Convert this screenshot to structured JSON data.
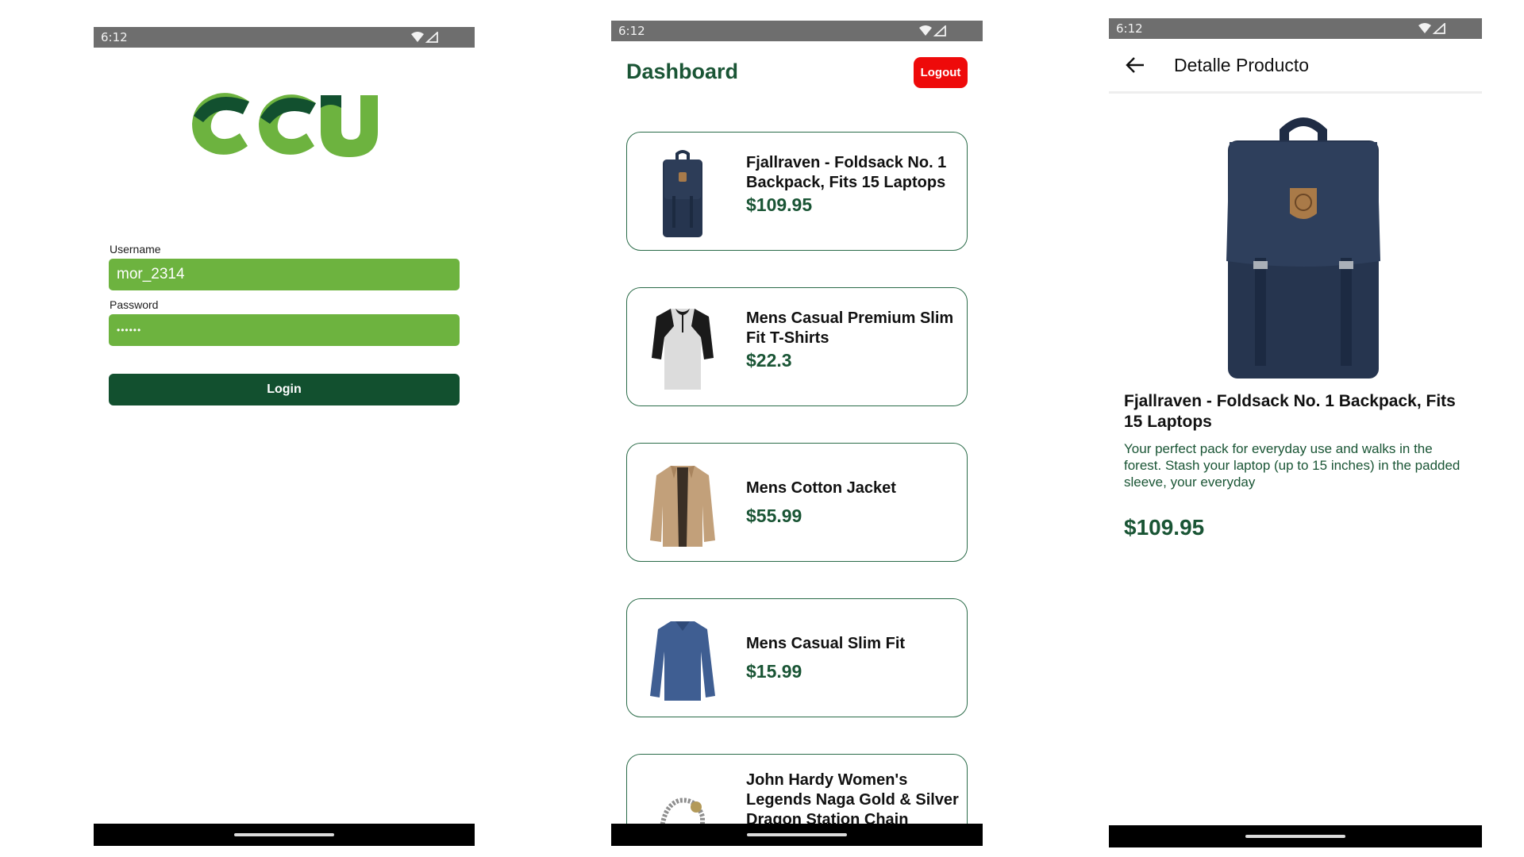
{
  "status_bar": {
    "time": "6:12"
  },
  "login": {
    "logo_text": "CCU",
    "username_label": "Username",
    "username_value": "mor_2314",
    "password_label": "Password",
    "password_value": "••••••",
    "login_button": "Login"
  },
  "dashboard": {
    "title": "Dashboard",
    "logout_button": "Logout",
    "products": [
      {
        "title": "Fjallraven - Foldsack No. 1 Backpack, Fits 15 Laptops",
        "price": "$109.95",
        "image": "backpack-image"
      },
      {
        "title": "Mens Casual Premium Slim Fit T-Shirts",
        "price": "$22.3",
        "image": "tshirt-image"
      },
      {
        "title": "Mens Cotton Jacket",
        "price": "$55.99",
        "image": "jacket-image"
      },
      {
        "title": "Mens Casual Slim Fit",
        "price": "$15.99",
        "image": "longsleeve-image"
      },
      {
        "title": "John Hardy Women's Legends Naga Gold & Silver Dragon Station Chain",
        "price": "",
        "image": "bracelet-image"
      }
    ]
  },
  "detail": {
    "app_bar_title": "Detalle Producto",
    "product_title": "Fjallraven - Foldsack No. 1 Backpack, Fits 15 Laptops",
    "description": "Your perfect pack for everyday use and walks in the forest. Stash your laptop (up to 15 inches) in the padded sleeve, your everyday",
    "price": "$109.95"
  },
  "colors": {
    "brand_green": "#6db33f",
    "dark_green": "#12502f",
    "text_green": "#1a5535",
    "logout_red": "#ee0a0a"
  }
}
